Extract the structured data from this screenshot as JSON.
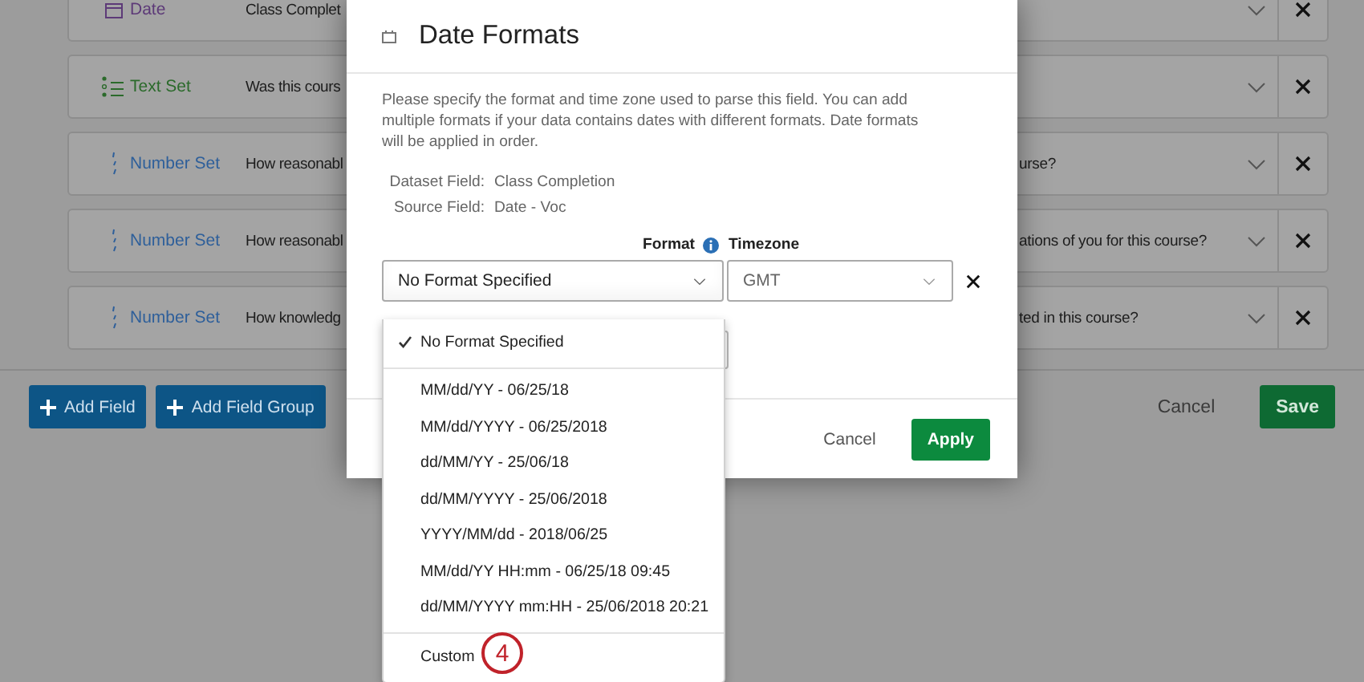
{
  "fields": [
    {
      "kind": "date",
      "type": "Date",
      "question_start": "Class Complet"
    },
    {
      "kind": "text_set",
      "type": "Text Set",
      "question_start": "Was this cours"
    },
    {
      "kind": "number_set",
      "type": "Number Set",
      "question_start": "How reasonabl",
      "question_end": "urse?"
    },
    {
      "kind": "number_set",
      "type": "Number Set",
      "question_start": "How reasonabl",
      "question_end": "ations of you for this course?"
    },
    {
      "kind": "number_set",
      "type": "Number Set",
      "question_start": "How knowledg",
      "question_end": "ted in this course?"
    }
  ],
  "footer": {
    "add_field": "Add Field",
    "add_field_group": "Add Field Group",
    "cancel": "Cancel",
    "save": "Save"
  },
  "modal": {
    "title": "Date Formats",
    "description": "Please specify the format and time zone used to parse this field. You can add multiple formats if your data contains dates with different formats. Date formats will be applied in order.",
    "info": [
      {
        "label": "Dataset Field:",
        "value": "Class Completion"
      },
      {
        "label": "Source Field:",
        "value": "Date - Voc"
      }
    ],
    "format_label": "Format",
    "timezone_label": "Timezone",
    "format_value": "No Format Specified",
    "timezone_value": "GMT",
    "option_groups": [
      [
        {
          "label": "No Format Specified",
          "selected": true
        }
      ],
      [
        {
          "label": "MM/dd/YY - 06/25/18",
          "selected": false
        },
        {
          "label": "MM/dd/YYYY - 06/25/2018",
          "selected": false
        },
        {
          "label": "dd/MM/YY - 25/06/18",
          "selected": false
        },
        {
          "label": "dd/MM/YYYY - 25/06/2018",
          "selected": false
        },
        {
          "label": "YYYY/MM/dd - 2018/06/25",
          "selected": false
        },
        {
          "label": "MM/dd/YY HH:mm - 06/25/18 09:45",
          "selected": false
        },
        {
          "label": "dd/MM/YYYY mm:HH - 25/06/2018 20:21",
          "selected": false
        }
      ],
      [
        {
          "label": "Custom",
          "selected": false
        }
      ]
    ],
    "cancel": "Cancel",
    "apply": "Apply"
  },
  "callout": "4"
}
